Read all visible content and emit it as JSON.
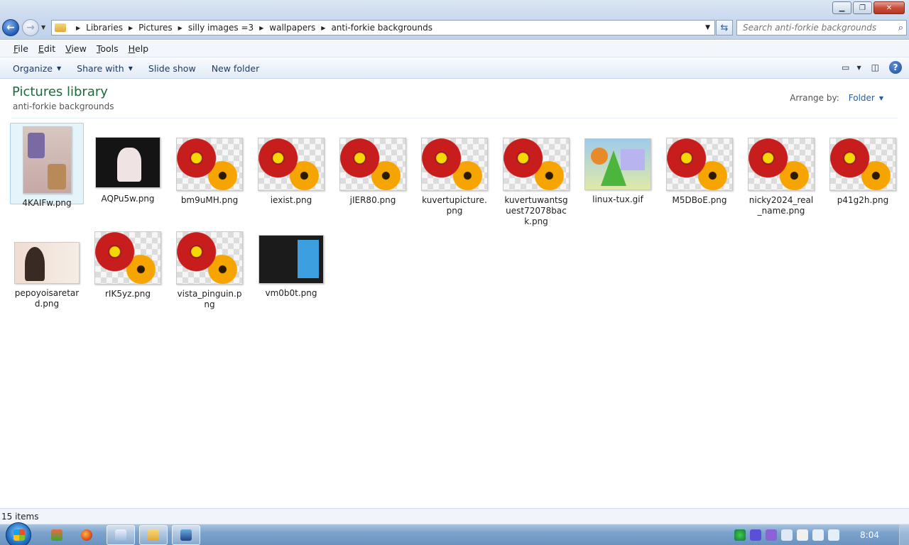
{
  "window": {
    "minimize": "▁",
    "maximize": "❐",
    "close": "✕"
  },
  "address": {
    "crumbs": [
      "Libraries",
      "Pictures",
      "silly images =3",
      "wallpapers",
      "anti-forkie backgrounds"
    ],
    "search_placeholder": "Search anti-forkie backgrounds"
  },
  "menu": [
    "File",
    "Edit",
    "View",
    "Tools",
    "Help"
  ],
  "toolbar": {
    "organize": "Organize",
    "share_with": "Share with",
    "slide_show": "Slide show",
    "new_folder": "New folder",
    "help": "?"
  },
  "library": {
    "title": "Pictures library",
    "subtitle": "anti-forkie backgrounds",
    "arrange_label": "Arrange by:",
    "arrange_value": "Folder"
  },
  "files": [
    {
      "name": "4KAIFw.png",
      "thumb": "collage"
    },
    {
      "name": "AQPu5w.png",
      "thumb": "dark"
    },
    {
      "name": "bm9uMH.png",
      "thumb": "flower"
    },
    {
      "name": "iexist.png",
      "thumb": "flower"
    },
    {
      "name": "jIER80.png",
      "thumb": "flower"
    },
    {
      "name": "kuvertupicture.png",
      "thumb": "flower"
    },
    {
      "name": "kuvertuwantsguest72078back.png",
      "thumb": "flower"
    },
    {
      "name": "linux-tux.gif",
      "thumb": "tux"
    },
    {
      "name": "M5DBoE.png",
      "thumb": "flower"
    },
    {
      "name": "nicky2024_real_name.png",
      "thumb": "flower"
    },
    {
      "name": "p41g2h.png",
      "thumb": "flower"
    },
    {
      "name": "pepoyoisaretard.png",
      "thumb": "kiss"
    },
    {
      "name": "rIK5yz.png",
      "thumb": "flower"
    },
    {
      "name": "vista_pinguin.png",
      "thumb": "flower"
    },
    {
      "name": "vm0b0t.png",
      "thumb": "shot"
    }
  ],
  "status": {
    "count": "15 items"
  },
  "taskbar": {
    "clock": "8:04"
  }
}
